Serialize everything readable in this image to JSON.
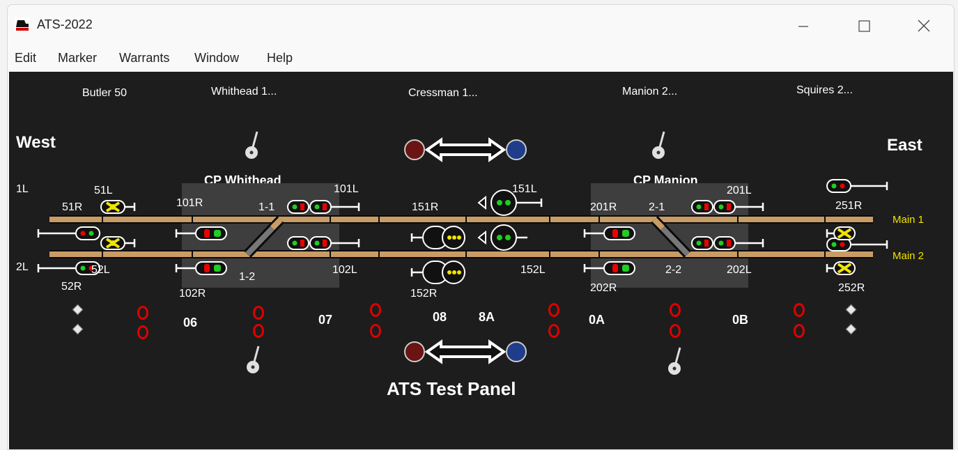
{
  "window": {
    "title": "ATS-2022"
  },
  "menu": [
    "Edit",
    "Marker",
    "Warrants",
    "Window",
    "Help"
  ],
  "panel": {
    "title": "ATS Test Panel",
    "west": "West",
    "east": "East",
    "track_names": [
      "Main 1",
      "Main 2"
    ],
    "stations": [
      "Butler 50",
      "Whithead 1...",
      "Cressman 1...",
      "Manion 2...",
      "Squires 2..."
    ],
    "control_points": [
      "CP Whithead",
      "CP Manion"
    ],
    "signal_labels": {
      "s1L": "1L",
      "s51L": "51L",
      "s51R": "51R",
      "s2L": "2L",
      "s52L": "52L",
      "s52R": "52R",
      "s101R": "101R",
      "s1_1": "1-1",
      "s101L": "101L",
      "s1_2": "1-2",
      "s102L": "102L",
      "s102R": "102R",
      "s151L": "151L",
      "s151R": "151R",
      "s152L": "152L",
      "s152R": "152R",
      "s201R": "201R",
      "s2_1": "2-1",
      "s201L": "201L",
      "s2_2": "2-2",
      "s202L": "202L",
      "s202R": "202R",
      "s251R": "251R",
      "s252R": "252R"
    },
    "block_labels": [
      "06",
      "07",
      "08",
      "8A",
      "0A",
      "0B"
    ]
  },
  "colors": {
    "panel_bg": "#1d1d1d",
    "rail": "#c99c65",
    "block": "#3e3e3e",
    "signal_red": "#e00000",
    "signal_green": "#22cc22",
    "signal_yellow": "#f0e400"
  },
  "icons": [
    "app-icon",
    "minimize-icon",
    "maximize-icon",
    "close-icon",
    "lever-icon",
    "direction-arrow-icon",
    "signal-icon",
    "indicator-lamp-icon"
  ]
}
